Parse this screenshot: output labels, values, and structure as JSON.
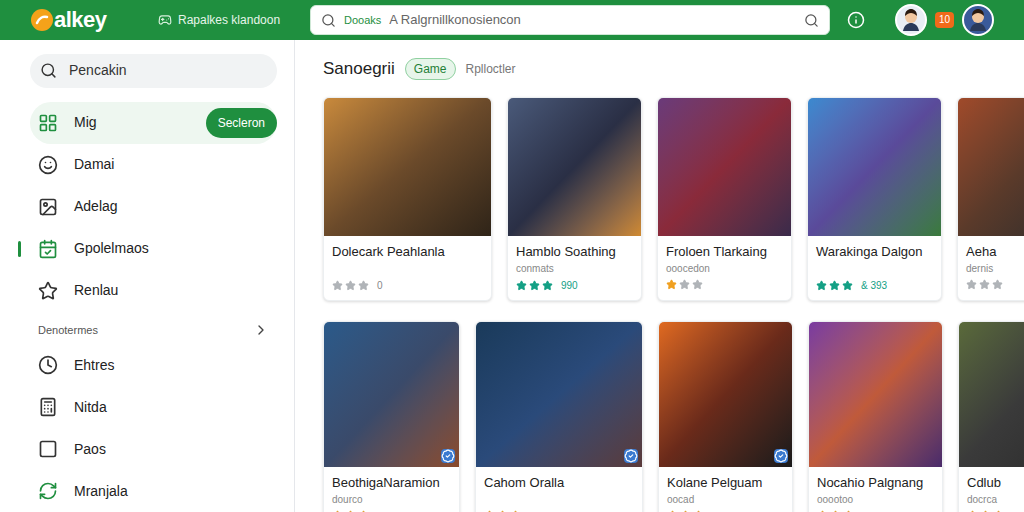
{
  "app": {
    "logo": "alkey",
    "nav_label": "Rapalkes klandoon"
  },
  "search": {
    "scope": "Dooaks",
    "placeholder": "A Ralgrnillkonosiencon"
  },
  "header": {
    "badge": "10"
  },
  "sidebar": {
    "search": "Pencakin",
    "items": [
      {
        "label": "Mig",
        "selected": true,
        "current": false,
        "action": "Secleron"
      },
      {
        "label": "Damai",
        "selected": false,
        "current": false,
        "action": ""
      },
      {
        "label": "Adelag",
        "selected": false,
        "current": false,
        "action": ""
      },
      {
        "label": "Gpolelmaos",
        "selected": false,
        "current": true,
        "action": ""
      },
      {
        "label": "Renlau",
        "selected": false,
        "current": false,
        "action": ""
      }
    ],
    "section": "Denotermes",
    "section_items": [
      {
        "label": "Ehtres"
      },
      {
        "label": "Nitda"
      },
      {
        "label": "Paos"
      },
      {
        "label": "Mranjala"
      }
    ]
  },
  "main": {
    "title": "Sanoegrii",
    "chips": [
      {
        "label": "Game",
        "selected": true
      },
      {
        "label": "Rplloctler",
        "selected": false
      }
    ]
  },
  "rows": [
    [
      {
        "title": "Dolecark Peahlanla",
        "subtitle": "",
        "stars": 0,
        "color": "#9ca3af",
        "reading": "0",
        "verified": false
      },
      {
        "title": "Hamblo Soathing",
        "subtitle": "conmats",
        "stars": 3,
        "color": "#14a085",
        "reading": "990",
        "verified": false
      },
      {
        "title": "Froloen Tlarkaing",
        "subtitle": "ooocedon",
        "stars": 1,
        "color": "#f0a020",
        "reading": "",
        "verified": false
      },
      {
        "title": "Warakinga Dalgon",
        "subtitle": "",
        "stars": 3,
        "color": "#14a085",
        "reading": "& 393",
        "verified": false
      },
      {
        "title": "Aeha",
        "subtitle": "dernis",
        "stars": 0,
        "color": "#9ca3af",
        "reading": "",
        "verified": false
      }
    ],
    [
      {
        "title": "BeothigaNaramion",
        "subtitle": "dourco",
        "stars": 3,
        "color": "#e0a030",
        "reading": "",
        "verified": true
      },
      {
        "title": "Cahom Oralla",
        "subtitle": "",
        "stars": 3,
        "color": "#e0a030",
        "reading": "",
        "verified": true
      },
      {
        "title": "Kolane Pelguam",
        "subtitle": "oocad",
        "stars": 3,
        "color": "#e0a030",
        "reading": "",
        "verified": true
      },
      {
        "title": "Nocahio Palgnang",
        "subtitle": "ooootoo",
        "stars": 3,
        "color": "#e0a030",
        "reading": "",
        "verified": false
      },
      {
        "title": "Cdlub",
        "subtitle": "docrca",
        "stars": 3,
        "color": "#e0a030",
        "reading": "",
        "verified": false
      }
    ]
  ]
}
